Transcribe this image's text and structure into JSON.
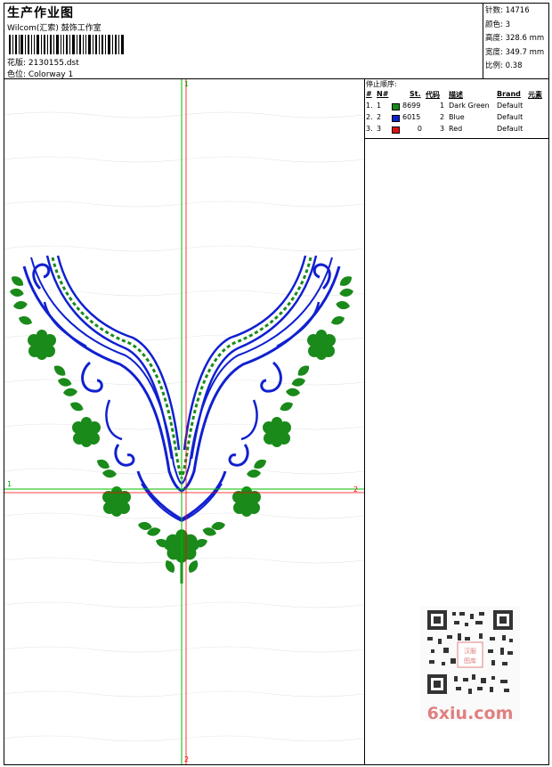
{
  "header": {
    "title": "生产作业图",
    "subtitle": "Wilcom(汇索) 鼓饰工作室",
    "design_label": "花版: 2130155.dst",
    "colorway_label": "色位: Colorway 1"
  },
  "info": {
    "stitches": "针数: 14716",
    "colors": "颜色: 3",
    "height": "高度: 328.6 mm",
    "width": "宽度: 349.7 mm",
    "ratio": "比例: 0.38"
  },
  "stop_sequence": {
    "title": "停止顺序:",
    "headers": [
      "#",
      "N#",
      "St.",
      "代码",
      "描述",
      "Brand",
      "元素"
    ],
    "rows": [
      {
        "num": "1.",
        "n": "1",
        "color": "#1a8a1a",
        "st": "8699",
        "code": "1",
        "desc": "Dark Green",
        "brand": "Default"
      },
      {
        "num": "2.",
        "n": "2",
        "color": "#1020d0",
        "st": "6015",
        "code": "2",
        "desc": "Blue",
        "brand": "Default"
      },
      {
        "num": "3.",
        "n": "3",
        "color": "#e01010",
        "st": "0",
        "code": "3",
        "desc": "Red",
        "brand": "Default"
      }
    ]
  },
  "axes": {
    "v_top": "1",
    "v_bottom": "2",
    "h_left": "1",
    "h_right": "2"
  },
  "watermark": {
    "site": "6xiu.com",
    "stamp": "汉服图库"
  },
  "colors": {
    "green": "#1a8a1a",
    "blue": "#1020d0",
    "red": "#e01010",
    "axis_green": "#00bb00",
    "axis_red": "#ff0000",
    "watermark": "#e08080"
  }
}
